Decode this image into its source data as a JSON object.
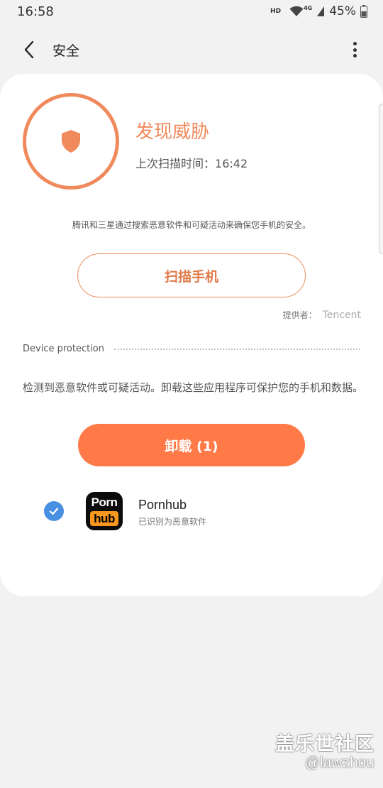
{
  "status_bar": {
    "time": "16:58",
    "hd": "HD",
    "network": "4G",
    "battery": "45%"
  },
  "app_bar": {
    "title": "安全"
  },
  "threat": {
    "title": "发现威胁",
    "last_scan_label": "上次扫描时间：",
    "last_scan_time": "16:42",
    "accent_color": "#f08a5d"
  },
  "description": "腾讯和三星通过搜索恶意软件和可疑活动来确保您手机的安全。",
  "scan_button": "扫描手机",
  "provider": {
    "label": "提供者：",
    "name": "Tencent"
  },
  "section": {
    "title": "Device protection"
  },
  "detection_text": "检测到恶意软件或可疑活动。卸载这些应用程序可保护您的手机和数据。",
  "uninstall_button": "卸载 (1)",
  "apps": [
    {
      "name": "Pornhub",
      "status": "已识别为恶意软件",
      "icon_line1": "Porn",
      "icon_line2": "hub",
      "checked": true
    }
  ],
  "watermark": {
    "line1": "盖乐世社区",
    "line2": "@lawzhou"
  }
}
